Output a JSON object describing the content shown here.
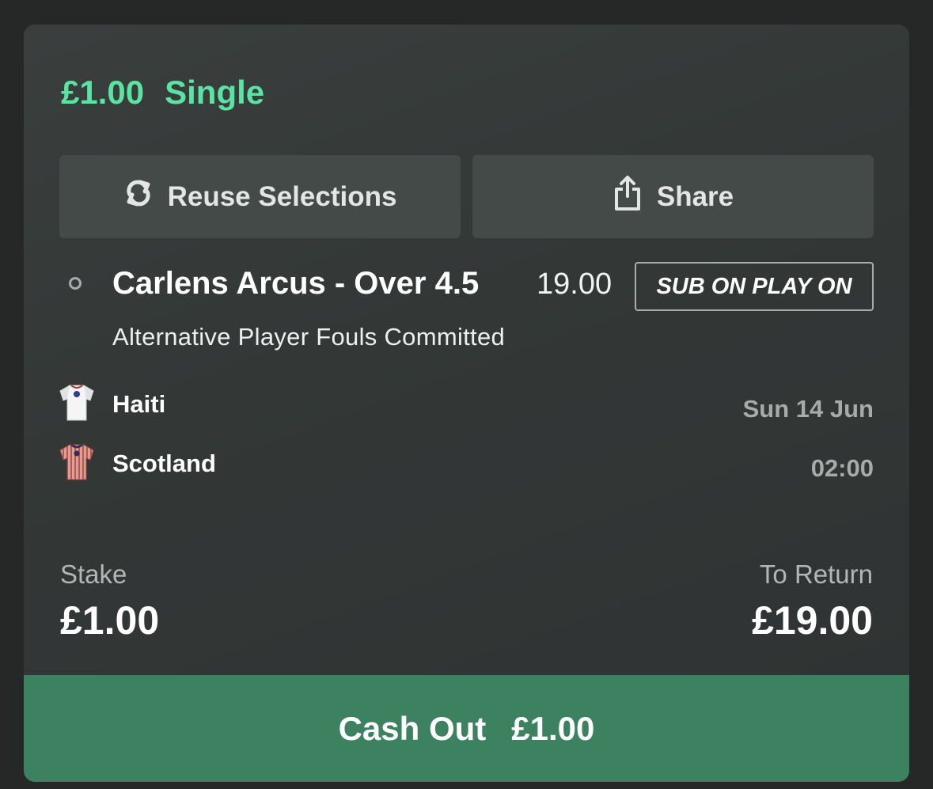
{
  "bet": {
    "stake_amount": "£1.00",
    "type": "Single"
  },
  "actions": {
    "reuse_label": "Reuse Selections",
    "share_label": "Share"
  },
  "selection": {
    "name": "Carlens Arcus - Over 4.5",
    "odds": "19.00",
    "badge": "SUB ON PLAY ON",
    "market": "Alternative Player Fouls Committed"
  },
  "event": {
    "home_team": "Haiti",
    "away_team": "Scotland",
    "date": "Sun 14 Jun",
    "time": "02:00"
  },
  "summary": {
    "stake_label": "Stake",
    "stake_value": "£1.00",
    "return_label": "To Return",
    "return_value": "£19.00"
  },
  "cashout": {
    "label": "Cash Out",
    "amount": "£1.00"
  },
  "icons": {
    "reuse": "refresh-icon",
    "share": "share-icon",
    "home_kit": "white-jersey-icon",
    "away_kit": "striped-jersey-icon"
  },
  "colors": {
    "accent": "#5be3a4",
    "cashout": "#3d8260"
  }
}
